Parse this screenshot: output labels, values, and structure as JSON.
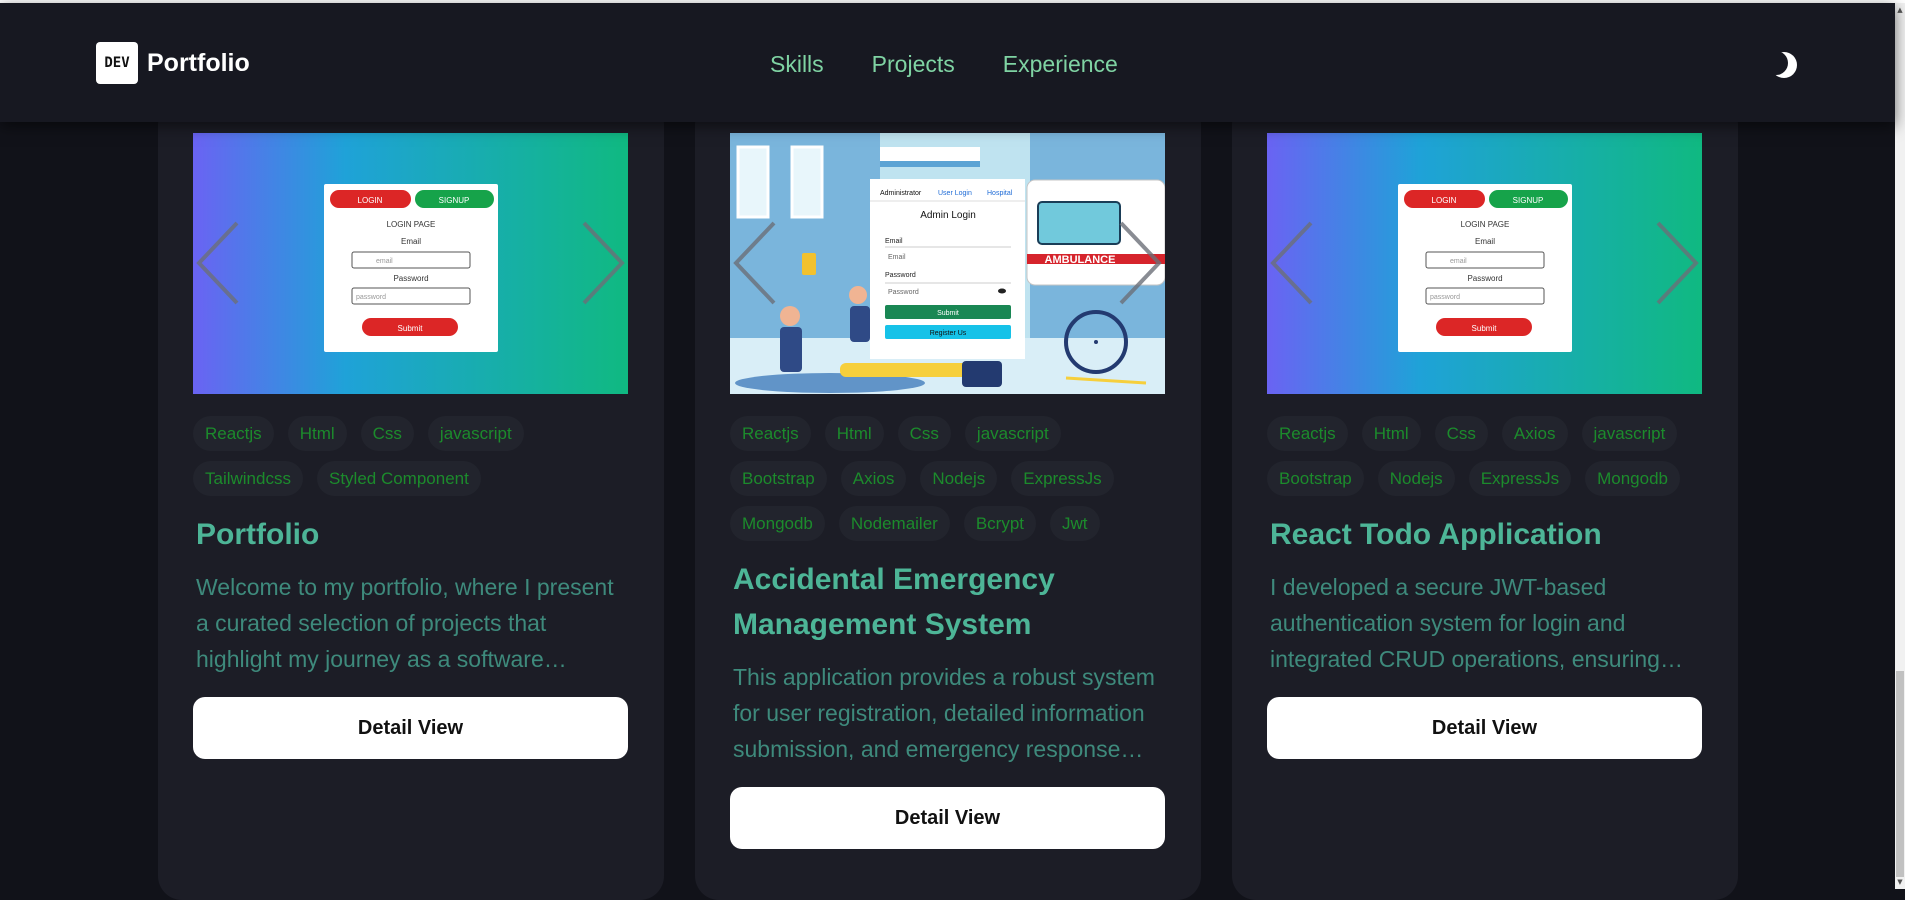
{
  "nav": {
    "logo_badge": "DEV",
    "logo_text": "Portfolio",
    "links": [
      "Skills",
      "Projects",
      "Experience"
    ],
    "theme_icon": "moon-icon"
  },
  "projects": [
    {
      "tags": [
        "Reactjs",
        "Html",
        "Css",
        "javascript",
        "Tailwindcss",
        "Styled Component"
      ],
      "title": "Portfolio",
      "description": "Welcome to my portfolio, where I present a curated selection of projects that highlight my journey as a software developer.",
      "button": "Detail View",
      "screenshot": {
        "login_tab": "LOGIN",
        "signup_tab": "SIGNUP",
        "heading": "LOGIN PAGE",
        "email_label": "Email",
        "email_placeholder": "email",
        "password_label": "Password",
        "password_placeholder": "password",
        "submit": "Submit"
      }
    },
    {
      "tags": [
        "Reactjs",
        "Html",
        "Css",
        "javascript",
        "Bootstrap",
        "Axios",
        "Nodejs",
        "ExpressJs",
        "Mongodb",
        "Nodemailer",
        "Bcrypt",
        "Jwt"
      ],
      "title": "Accidental Emergency Management System",
      "description": "This application provides a robust system for user registration, detailed information submission, and emergency response management.",
      "button": "Detail View",
      "screenshot": {
        "tabs": [
          "Administrator",
          "User Login",
          "Hospital"
        ],
        "heading": "Admin Login",
        "email_label": "Email",
        "email_placeholder": "Email",
        "password_label": "Password",
        "password_placeholder": "Password",
        "submit": "Submit",
        "register": "Register Us",
        "ambulance": "AMBULANCE"
      }
    },
    {
      "tags": [
        "Reactjs",
        "Html",
        "Css",
        "Axios",
        "javascript",
        "Bootstrap",
        "Nodejs",
        "ExpressJs",
        "Mongodb"
      ],
      "title": "React Todo Application",
      "description": "I developed a secure JWT-based authentication system for login and integrated CRUD operations, ensuring efficient task management.",
      "button": "Detail View",
      "screenshot": {
        "login_tab": "LOGIN",
        "signup_tab": "SIGNUP",
        "heading": "LOGIN PAGE",
        "email_label": "Email",
        "email_placeholder": "email",
        "password_label": "Password",
        "password_placeholder": "password",
        "submit": "Submit"
      }
    }
  ],
  "colors": {
    "background": "#111219",
    "navbar": "#171821",
    "card": "#1c1d26",
    "nav_link": "#7fd3a3",
    "tag_text": "#1c8b2c",
    "title": "#4db597",
    "description": "#3e8a7c"
  }
}
